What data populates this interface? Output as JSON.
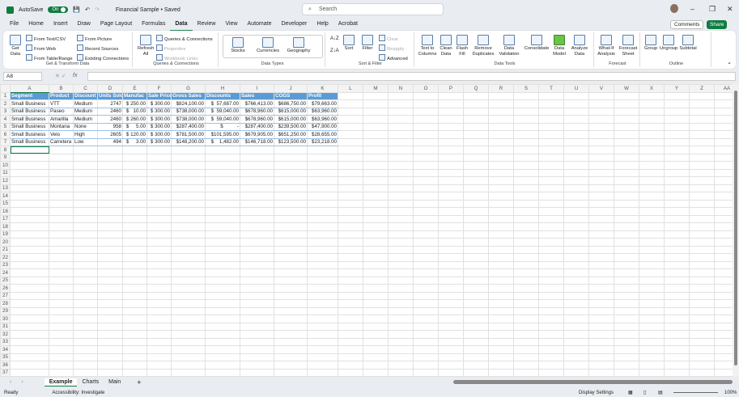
{
  "title": {
    "autosave": "AutoSave",
    "toggle": "On",
    "doc": "Financial Sample • Saved",
    "search_placeholder": "Search"
  },
  "menu": [
    "File",
    "Home",
    "Insert",
    "Draw",
    "Page Layout",
    "Formulas",
    "Data",
    "Review",
    "View",
    "Automate",
    "Developer",
    "Help",
    "Acrobat"
  ],
  "comments": "Comments",
  "share": "Share",
  "ribbon": {
    "get_data": "Get Data",
    "from_text": "From Text/CSV",
    "from_web": "From Web",
    "from_table": "From Table/Range",
    "from_picture": "From Picture",
    "recent": "Recent Sources",
    "existing": "Existing Connections",
    "g1": "Get & Transform Data",
    "refresh": "Refresh All",
    "queries": "Queries & Connections",
    "properties": "Properties",
    "workbook_links": "Workbook Links",
    "g2": "Queries & Connections",
    "stocks": "Stocks",
    "currencies": "Currencies",
    "geography": "Geography",
    "g3": "Data Types",
    "sort": "Sort",
    "filter": "Filter",
    "clear": "Clear",
    "reapply": "Reapply",
    "advanced": "Advanced",
    "g4": "Sort & Filter",
    "text_to_columns": "Text to Columns",
    "clean_data": "Clean Data",
    "flash_fill": "Flash Fill",
    "remove_dup": "Remove Duplicates",
    "data_validation": "Data Validation",
    "consolidate": "Consolidate",
    "data_model": "Data Model",
    "analyze": "Analyze Data",
    "g5": "Data Tools",
    "whatif": "What-If Analysis",
    "forecast_sheet": "Forecast Sheet",
    "g6": "Forecast",
    "group": "Group",
    "ungroup": "Ungroup",
    "subtotal": "Subtotal",
    "g7": "Outline"
  },
  "namebox": "A8",
  "fx": "fx",
  "columns": [
    "A",
    "B",
    "C",
    "D",
    "E",
    "F",
    "G",
    "H",
    "I",
    "J",
    "K",
    "L",
    "M",
    "N",
    "O",
    "P",
    "Q",
    "R",
    "S",
    "T",
    "U",
    "V",
    "W",
    "X",
    "Y",
    "Z",
    "AA"
  ],
  "table": {
    "headers": [
      "Segment",
      "Product",
      "Discount",
      "Units Sold",
      "Manufac",
      "Sale Price",
      "Gross Sales",
      "Discounts",
      "Sales",
      "COGS",
      "Profit"
    ],
    "rows": [
      [
        "Small Business",
        "VTT",
        "Medium",
        "2747",
        "$ 250.00",
        "$ 300.00",
        "$824,100.00",
        "$  57,687.00",
        "$766,413.00",
        "$686,750.00",
        "$79,663.00"
      ],
      [
        "Small Business",
        "Paseo",
        "Medium",
        "2460",
        "$   10.00",
        "$ 300.00",
        "$738,000.00",
        "$  59,040.00",
        "$678,960.00",
        "$615,000.00",
        "$63,960.00"
      ],
      [
        "Small Business",
        "Amarilla",
        "Medium",
        "2460",
        "$ 260.00",
        "$ 300.00",
        "$738,000.00",
        "$  59,040.00",
        "$678,960.00",
        "$615,000.00",
        "$63,960.00"
      ],
      [
        "Small Business",
        "Montana",
        "None",
        "958",
        "$     5.00",
        "$ 300.00",
        "$287,400.00",
        "$          -",
        "$287,400.00",
        "$239,500.00",
        "$47,900.00"
      ],
      [
        "Small Business",
        "Velo",
        "High",
        "2605",
        "$ 120.00",
        "$ 300.00",
        "$781,500.00",
        "$101,595.00",
        "$679,905.00",
        "$651,250.00",
        "$28,655.00"
      ],
      [
        "Small Business",
        "Carretera",
        "Low",
        "494",
        "$     3.00",
        "$ 300.00",
        "$148,200.00",
        "$    1,482.00",
        "$146,718.00",
        "$123,500.00",
        "$23,218.00"
      ]
    ]
  },
  "sheets": [
    "Example",
    "Charts",
    "Main"
  ],
  "status": {
    "ready": "Ready",
    "accessibility": "Accessibility: Investigate",
    "display": "Display Settings",
    "zoom": "100%"
  }
}
